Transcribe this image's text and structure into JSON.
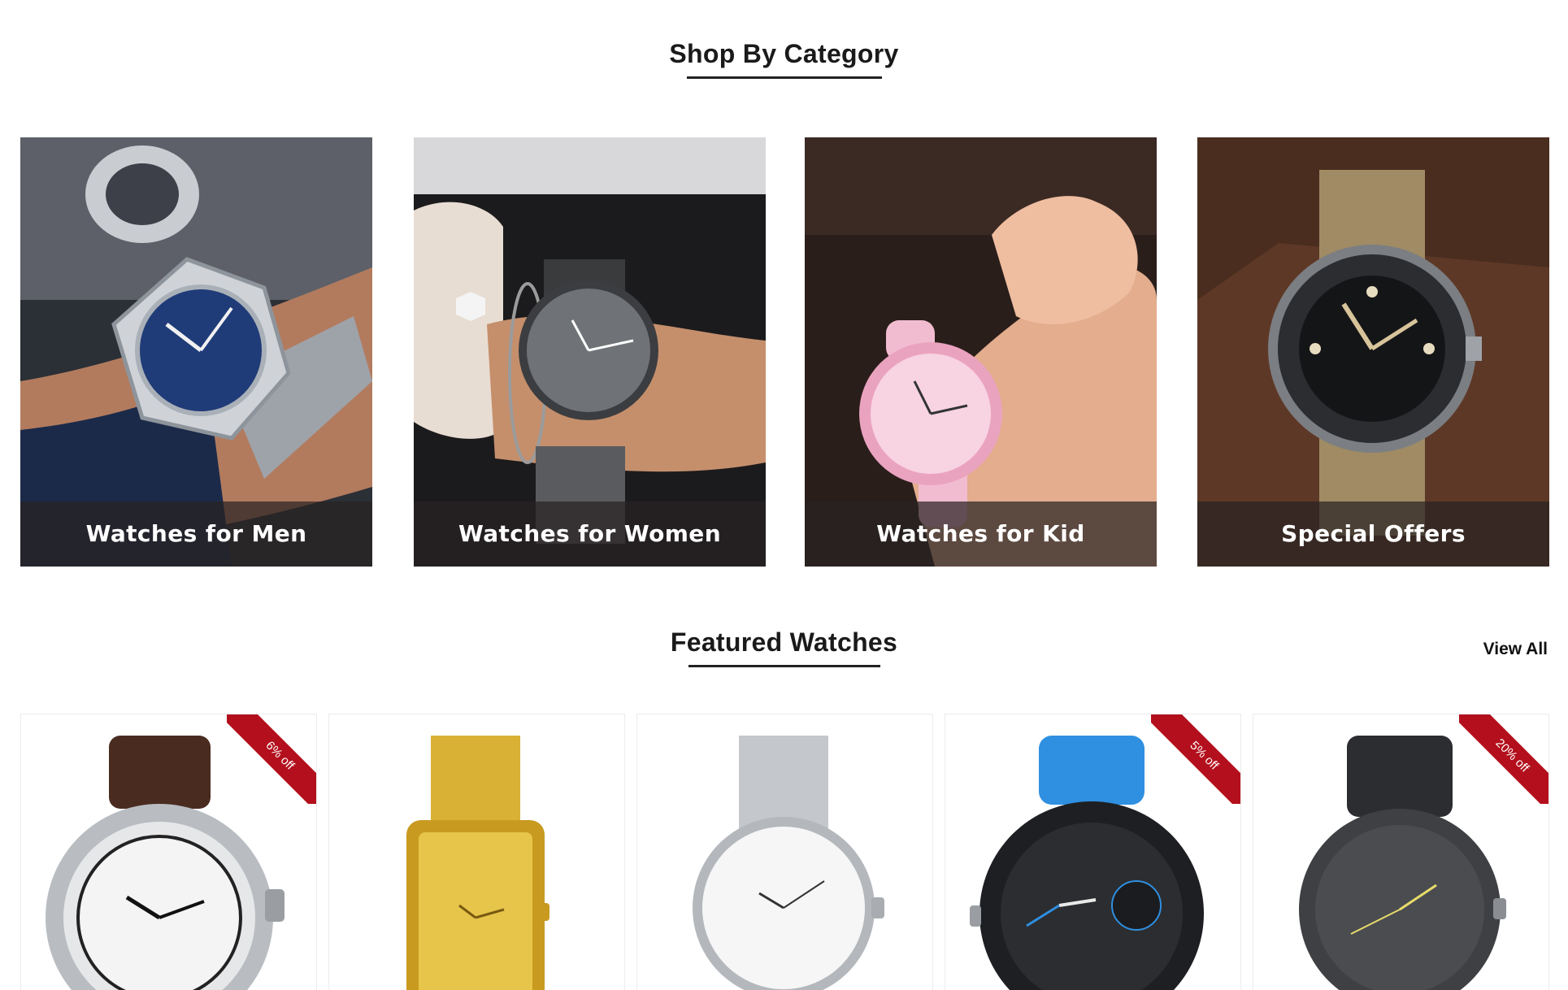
{
  "sections": {
    "shop_by_category": {
      "title": "Shop By Category",
      "categories": [
        {
          "label": "Watches for Men"
        },
        {
          "label": "Watches for Women"
        },
        {
          "label": "Watches for Kid"
        },
        {
          "label": "Special Offers"
        }
      ]
    },
    "featured": {
      "title": "Featured Watches",
      "view_all_label": "View All",
      "products": [
        {
          "badge": "6% off"
        },
        {
          "badge": ""
        },
        {
          "badge": ""
        },
        {
          "badge": "5% off"
        },
        {
          "badge": "20% off"
        }
      ]
    }
  },
  "colors": {
    "badge": "#b30f1c",
    "heading": "#1a1a1a"
  }
}
